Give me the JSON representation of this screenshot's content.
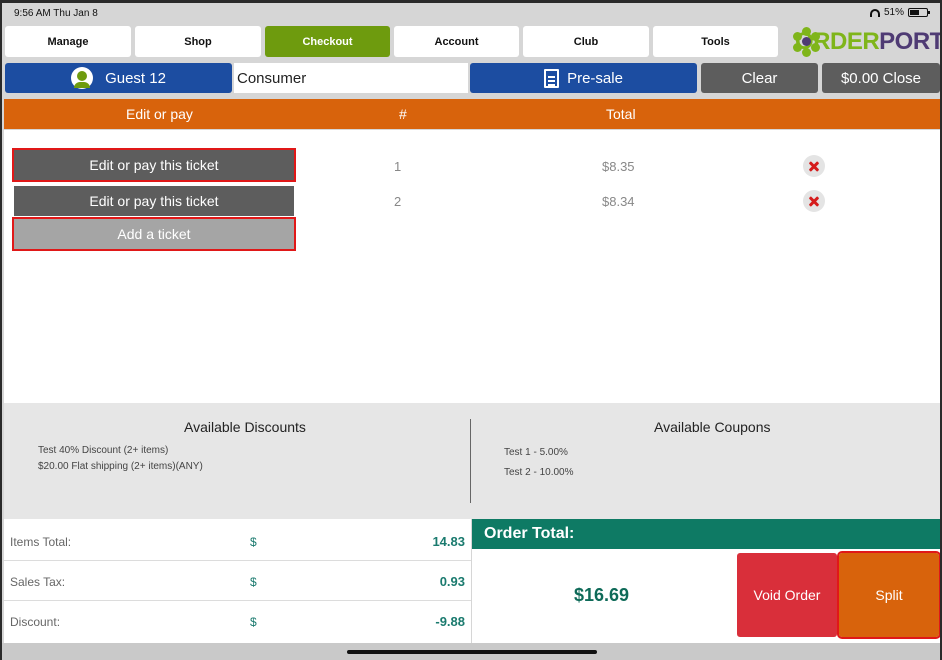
{
  "status": {
    "time": "9:56 AM  Thu Jan 8",
    "battery": "51%"
  },
  "nav": {
    "tabs": [
      {
        "label": "Manage"
      },
      {
        "label": "Shop"
      },
      {
        "label": "Checkout"
      },
      {
        "label": "Account"
      },
      {
        "label": "Club"
      },
      {
        "label": "Tools"
      }
    ],
    "active_tab": "Checkout",
    "logo_order": "ORDER",
    "logo_port": "PORT"
  },
  "toolbar": {
    "guest": "Guest 12",
    "customer_type": "Consumer",
    "presale": "Pre-sale",
    "clear": "Clear",
    "close": "$0.00 Close"
  },
  "table": {
    "headers": {
      "action": "Edit or pay",
      "number": "#",
      "total": "Total"
    },
    "rows": [
      {
        "action": "Edit or pay this ticket",
        "number": "1",
        "total": "$8.35"
      },
      {
        "action": "Edit or pay this ticket",
        "number": "2",
        "total": "$8.34"
      }
    ],
    "add_ticket": "Add a ticket"
  },
  "discounts": {
    "title": "Available Discounts",
    "items": [
      "Test 40% Discount (2+ items)",
      "$20.00 Flat shipping (2+ items)(ANY)"
    ]
  },
  "coupons": {
    "title": "Available Coupons",
    "items": [
      "Test 1 - 5.00%",
      "Test 2 - 10.00%"
    ]
  },
  "summary": [
    {
      "label": "Items Total:",
      "currency": "$",
      "value": "14.83"
    },
    {
      "label": "Sales Tax:",
      "currency": "$",
      "value": "0.93"
    },
    {
      "label": "Discount:",
      "currency": "$",
      "value": "-9.88"
    }
  ],
  "order_total": {
    "label": "Order Total:",
    "amount": "$16.69",
    "void": "Void Order",
    "split": "Split"
  },
  "colors": {
    "active_tab": "#6e9b0e",
    "primary_blue": "#1c4da1",
    "accent_orange": "#d8630c",
    "total_green": "#0e7a64",
    "void_red": "#d92f3a"
  }
}
